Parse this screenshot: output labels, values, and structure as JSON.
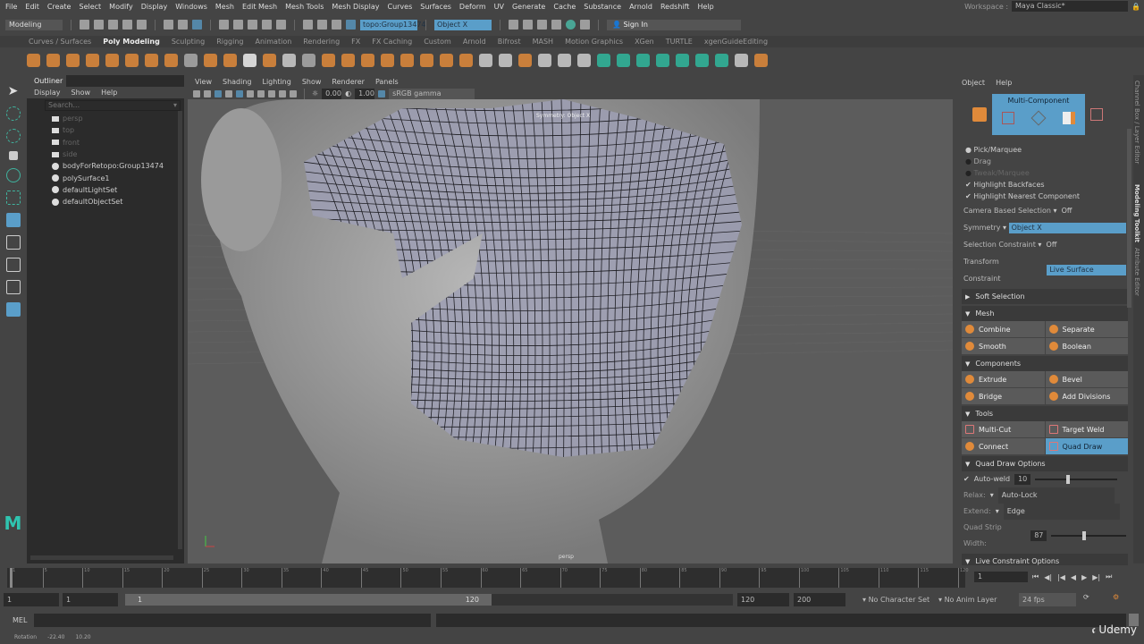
{
  "menubar": {
    "items": [
      "File",
      "Edit",
      "Create",
      "Select",
      "Modify",
      "Display",
      "Windows",
      "Mesh",
      "Edit Mesh",
      "Mesh Tools",
      "Mesh Display",
      "Curves",
      "Surfaces",
      "Deform",
      "UV",
      "Generate",
      "Cache",
      "Substance",
      "Arnold",
      "Redshift",
      "Help"
    ],
    "workspace_label": "Workspace :",
    "workspace_value": "Maya Classic*"
  },
  "statusline": {
    "mode": "Modeling",
    "object_field": "topo:Group13474",
    "symmetry_field": "Object X",
    "sign_in": "Sign In"
  },
  "shelf": {
    "tabs": [
      "Curves / Surfaces",
      "Poly Modeling",
      "Sculpting",
      "Rigging",
      "Animation",
      "Rendering",
      "FX",
      "FX Caching",
      "Custom",
      "Arnold",
      "Bifrost",
      "MASH",
      "Motion Graphics",
      "XGen",
      "TURTLE",
      "xgenGuideEditing"
    ],
    "active_tab": "Poly Modeling"
  },
  "outliner": {
    "title": "Outliner",
    "menu": [
      "Display",
      "Show",
      "Help"
    ],
    "search_placeholder": "Search...",
    "items": [
      {
        "label": "persp",
        "dim": true
      },
      {
        "label": "top",
        "dim": true
      },
      {
        "label": "front",
        "dim": true
      },
      {
        "label": "side",
        "dim": true
      },
      {
        "label": "bodyForRetopo:Group13474",
        "dim": false
      },
      {
        "label": "polySurface1",
        "dim": false
      },
      {
        "label": "defaultLightSet",
        "dim": false
      },
      {
        "label": "defaultObjectSet",
        "dim": false
      }
    ]
  },
  "viewport": {
    "menu": [
      "View",
      "Shading",
      "Lighting",
      "Show",
      "Renderer",
      "Panels"
    ],
    "exposure": "0.00",
    "gamma": "1.00",
    "colorspace": "sRGB gamma",
    "symmetry_label": "Symmetry: Object X",
    "camera": "persp"
  },
  "modeling_toolkit": {
    "menu": [
      "Object",
      "Help"
    ],
    "mode_title": "Multi-Component",
    "pick_options": [
      "Pick/Marquee",
      "Drag",
      "Tweak/Marquee"
    ],
    "highlight_backfaces": "Highlight Backfaces",
    "highlight_nearest": "Highlight Nearest Component",
    "camera_based_label": "Camera Based Selection",
    "camera_based_value": "Off",
    "symmetry_label": "Symmetry",
    "symmetry_value": "Object X",
    "sel_constraint_label": "Selection Constraint",
    "sel_constraint_value": "Off",
    "transform_constraint_label": "Transform Constraint",
    "transform_constraint_value": "Live Surface",
    "soft_selection": "Soft Selection",
    "mesh_section": "Mesh",
    "mesh_buttons": [
      "Combine",
      "Separate",
      "Smooth",
      "Boolean"
    ],
    "components_section": "Components",
    "components_buttons": [
      "Extrude",
      "Bevel",
      "Bridge",
      "Add Divisions"
    ],
    "tools_section": "Tools",
    "tools_buttons": [
      "Multi-Cut",
      "Target Weld",
      "Connect",
      "Quad Draw"
    ],
    "quad_draw_options": "Quad Draw Options",
    "auto_weld_label": "Auto-weld",
    "auto_weld_value": "10",
    "relax_label": "Relax:",
    "relax_value": "Auto-Lock",
    "extend_label": "Extend:",
    "extend_value": "Edge",
    "strip_width_label": "Quad Strip Width:",
    "strip_width_value": "87",
    "live_constraint": "Live Constraint Options"
  },
  "vertical_tabs": [
    "Channel Box / Layer Editor",
    "Modeling Toolkit",
    "Attribute Editor"
  ],
  "timeline": {
    "ticks": [
      "1",
      "5",
      "10",
      "15",
      "20",
      "25",
      "30",
      "35",
      "40",
      "45",
      "50",
      "55",
      "60",
      "65",
      "70",
      "75",
      "80",
      "85",
      "90",
      "95",
      "100",
      "105",
      "110",
      "115",
      "120"
    ],
    "current_frame": "1"
  },
  "range": {
    "start": "1",
    "playback_start": "1",
    "slider_start": "1",
    "slider_end": "120",
    "playback_end": "120",
    "end": "200",
    "character_set": "No Character Set",
    "anim_layer": "No Anim Layer",
    "fps": "24 fps"
  },
  "mel": {
    "label": "MEL"
  },
  "helpline": {
    "label": "Rotation",
    "v1": "-22.40",
    "v2": "10.20"
  },
  "watermark": "Udemy"
}
